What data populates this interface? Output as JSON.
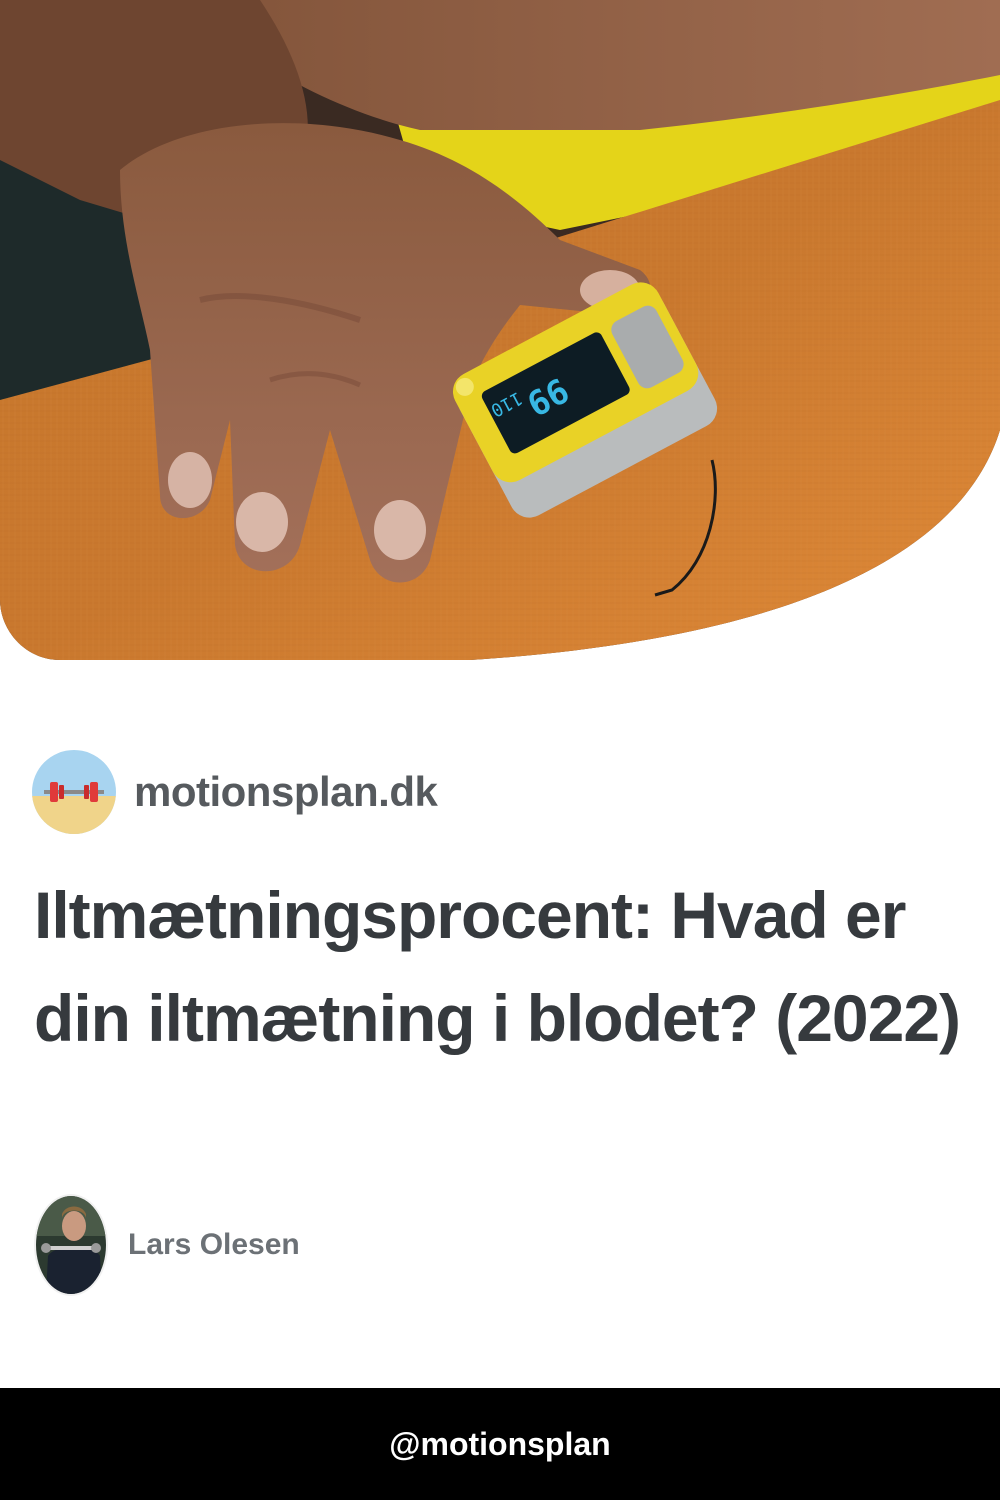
{
  "hero": {
    "image": "pulse-oximeter-on-finger-photo",
    "device_display": {
      "spo2": "99",
      "pulse": "110"
    }
  },
  "site": {
    "logo_icon": "dumbbell-beach-icon",
    "name": "motionsplan.dk"
  },
  "article": {
    "title": "Iltmætningsprocent: Hvad er din iltmætning i blodet? (2022)"
  },
  "author": {
    "avatar_icon": "author-photo",
    "name": "Lars Olesen"
  },
  "footer": {
    "handle": "@motionsplan"
  },
  "colors": {
    "title": "#363a3e",
    "site_name": "#565a5e",
    "author_name": "#6c7176",
    "footer_bg": "#000000",
    "footer_text": "#ffffff"
  }
}
